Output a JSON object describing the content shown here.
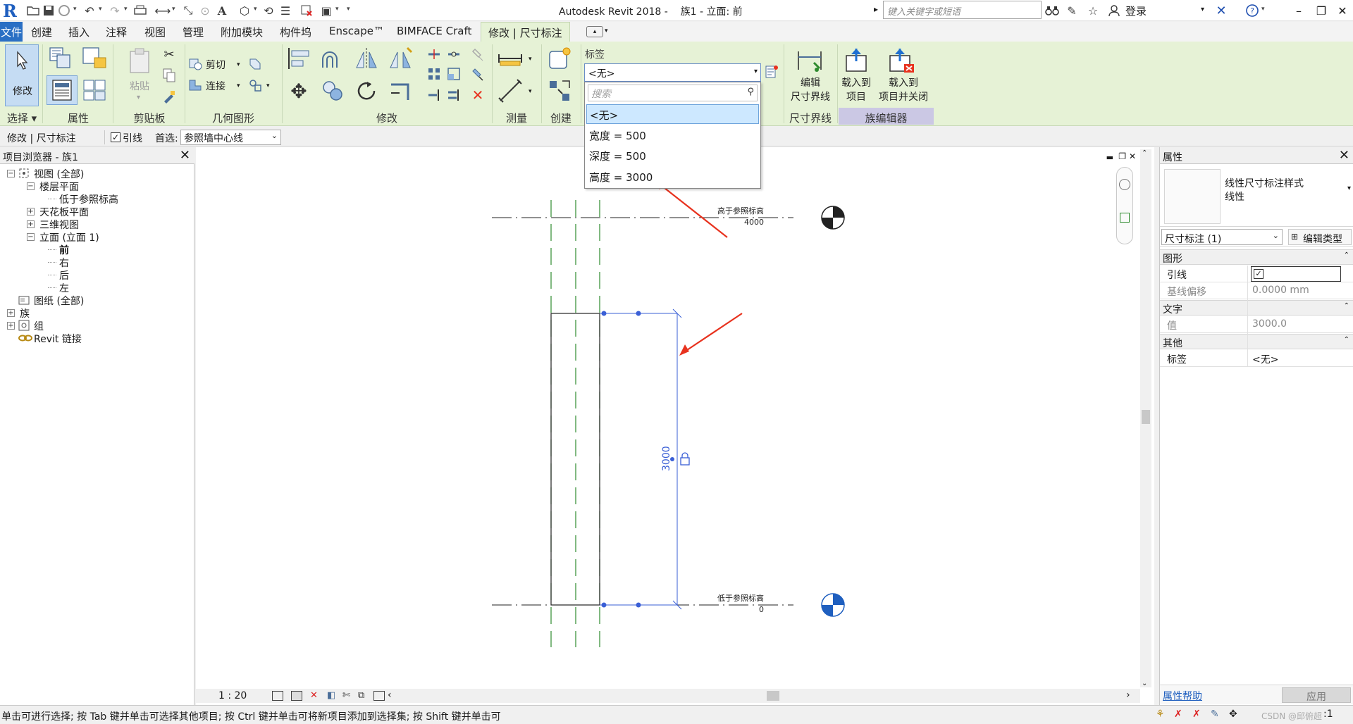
{
  "titlebar": {
    "title": "Autodesk Revit 2018 -    族1 - 立面: 前",
    "search_placeholder": "键入关键字或短语",
    "login": "登录"
  },
  "menu": {
    "file": "文件",
    "tabs": [
      "创建",
      "插入",
      "注释",
      "视图",
      "管理",
      "附加模块",
      "构件坞",
      "Enscape™",
      "BIMFACE Craft",
      "修改 | 尺寸标注"
    ]
  },
  "ribbon": {
    "modify_label": "修改",
    "select_label": "选择 ▾",
    "panels": {
      "properties": "属性",
      "clipboard": "剪贴板",
      "geometry": "几何图形",
      "modify": "修改",
      "measure": "测量",
      "create": "创建",
      "label_panel": "标签",
      "dimension_extension": "尺寸界线",
      "family_editor": "族编辑器"
    },
    "paste": "粘贴",
    "cut": "剪切",
    "join": "连接",
    "edit_witness_line_1": "编辑",
    "edit_witness_line_2": "尺寸界线",
    "load_into_project_1": "载入到",
    "load_into_project_2": "项目",
    "load_and_close_1": "载入到",
    "load_and_close_2": "项目并关闭"
  },
  "label_dropdown": {
    "value": "<无>",
    "search_placeholder": "搜索",
    "options": [
      "<无>",
      "宽度 = 500",
      "深度 = 500",
      "高度 = 3000"
    ],
    "selected_index": 0
  },
  "options_bar": {
    "context": "修改 | 尺寸标注",
    "leader_label": "引线",
    "leader_checked": true,
    "prefer_label": "首选:",
    "prefer_value": "参照墙中心线"
  },
  "project_browser": {
    "title": "项目浏览器 - 族1",
    "items": [
      {
        "label": "视图 (全部)",
        "toggle": "−"
      },
      {
        "label": "楼层平面",
        "toggle": "−"
      },
      {
        "label": "低于参照标高",
        "toggle": ""
      },
      {
        "label": "天花板平面",
        "toggle": "+"
      },
      {
        "label": "三维视图",
        "toggle": "+"
      },
      {
        "label": "立面 (立面 1)",
        "toggle": "−"
      },
      {
        "label": "前",
        "toggle": ""
      },
      {
        "label": "右",
        "toggle": ""
      },
      {
        "label": "后",
        "toggle": ""
      },
      {
        "label": "左",
        "toggle": ""
      },
      {
        "label": "图纸 (全部)",
        "toggle": ""
      },
      {
        "label": "族",
        "toggle": "+"
      },
      {
        "label": "组",
        "toggle": "+"
      },
      {
        "label": "Revit 链接",
        "toggle": ""
      }
    ]
  },
  "drawing": {
    "top_level_name": "高于参照标高",
    "top_level_value": "4000",
    "bottom_level_name": "低于参照标高",
    "bottom_level_value": "0",
    "dimension_value": "3000",
    "scale": "1 : 20"
  },
  "properties": {
    "title": "属性",
    "type_name_1": "线性尺寸标注样式",
    "type_name_2": "线性",
    "selector": "尺寸标注 (1)",
    "edit_type": "编辑类型",
    "groups": {
      "graphics": "图形",
      "text": "文字",
      "other": "其他"
    },
    "rows": {
      "leader_label": "引线",
      "leader_checked": true,
      "baseline_offset_label": "基线偏移",
      "baseline_offset_value": "0.0000 mm",
      "value_label": "值",
      "value_value": "3000.0",
      "label_label": "标签",
      "label_value": "<无>"
    },
    "help_link": "属性帮助",
    "apply": "应用"
  },
  "status": {
    "text": "单击可进行选择; 按 Tab 键并单击可选择其他项目; 按 Ctrl 键并单击可将新项目添加到选择集; 按 Shift 键并单击可",
    "filter_count": ":1",
    "watermark": "CSDN @邱俯超"
  },
  "colors": {
    "ribbon_bg": "#e6f2d6",
    "accent_blue": "#2a6fc4",
    "annotation_red": "#e8321e",
    "reference_green": "#2e8b2e",
    "dimension_blue": "#3a5fd6"
  }
}
